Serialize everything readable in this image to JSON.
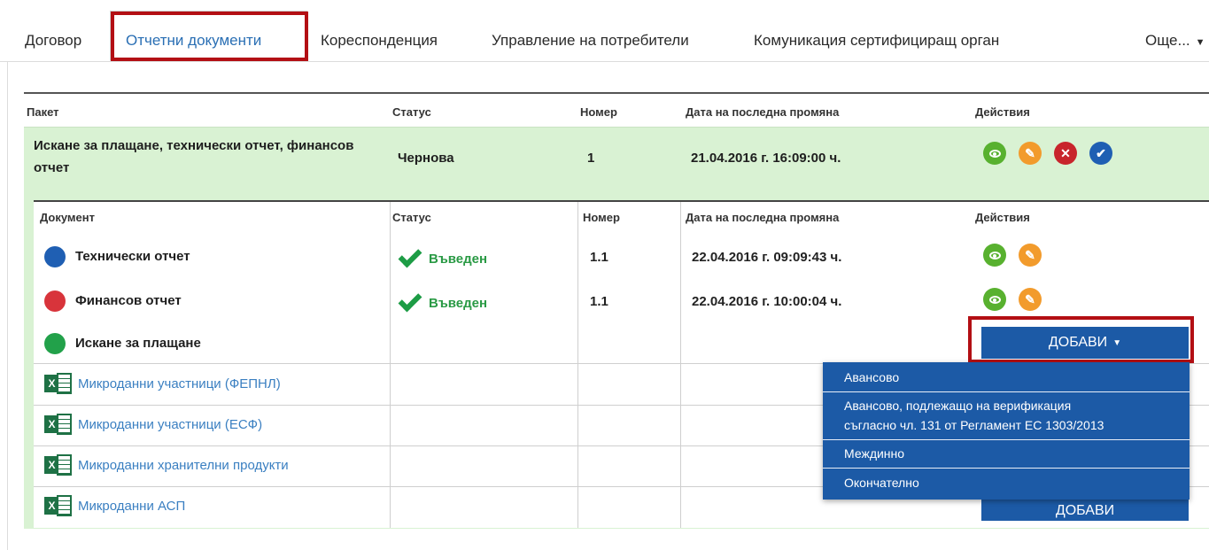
{
  "tabs": [
    "Договор",
    "Отчетни документи",
    "Кореспонденция",
    "Управление на потребители",
    "Комуникация сертифициращ орган",
    "Още..."
  ],
  "package_table": {
    "headers": [
      "Пакет",
      "Статус",
      "Номер",
      "Дата на последна промяна",
      "Действия"
    ],
    "row": {
      "name_line1": "Искане за плащане, технически отчет, финансов",
      "name_line2": "отчет",
      "status": "Чернова",
      "number": "1",
      "date": "21.04.2016 г. 16:09:00 ч."
    }
  },
  "document_table": {
    "headers": [
      "Документ",
      "Статус",
      "Номер",
      "Дата на последна промяна",
      "Действия"
    ],
    "rows": [
      {
        "name": "Технически отчет",
        "status": "Въведен",
        "number": "1.1",
        "date": "22.04.2016 г. 09:09:43 ч."
      },
      {
        "name": "Финансов отчет",
        "status": "Въведен",
        "number": "1.1",
        "date": "22.04.2016 г. 10:00:04 ч."
      },
      {
        "name": "Искане за плащане"
      }
    ],
    "microdata": [
      "Микроданни участници (ФЕПНЛ)",
      "Микроданни участници (ЕСФ)",
      "Микроданни хранителни продукти",
      "Микроданни АСП"
    ]
  },
  "add_button": "ДОБАВИ",
  "add_button_2": "ДОБАВИ",
  "dropdown": {
    "items": [
      "Авансово",
      "Авансово, подлежащо на верификация",
      "съгласно чл. 131 от Регламент ЕС 1303/2013",
      "Междинно",
      "Окончателно"
    ]
  },
  "icons": {
    "view": "eye-icon",
    "edit": "pencil-icon",
    "delete": "close-icon",
    "submit": "check-icon"
  },
  "colors": {
    "accent": "#1c5aa6",
    "highlight_frame": "#b30f14",
    "row_green": "#d9f2d3",
    "status_green": "#2a9a45",
    "link_blue": "#3a7fc1"
  }
}
